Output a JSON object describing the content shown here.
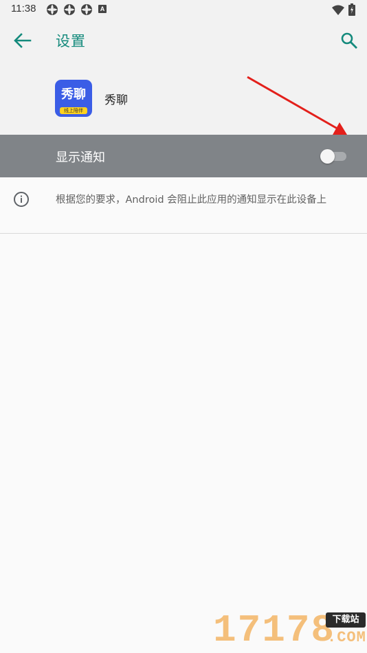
{
  "status_bar": {
    "time": "11:38",
    "icons": [
      "app-notification-icon",
      "app-notification-icon",
      "app-notification-icon",
      "a-notification-icon",
      "wifi-icon",
      "battery-icon"
    ],
    "a_label": "A"
  },
  "app_bar": {
    "title": "设置",
    "back_icon": "arrow-back-icon",
    "search_icon": "search-icon",
    "accent_color": "#148a7c"
  },
  "app_header": {
    "app_name": "秀聊",
    "icon_text": "秀聊",
    "icon_subtitle": "线上陪伴",
    "icon_color": "#3b5de6"
  },
  "notification_setting": {
    "label": "显示通知",
    "enabled": false
  },
  "info": {
    "icon": "info-icon",
    "text": "根据您的要求，Android 会阻止此应用的通知显示在此设备上"
  },
  "watermark": {
    "number": "17178",
    "badge": "下载站",
    "domain": ".COM"
  }
}
